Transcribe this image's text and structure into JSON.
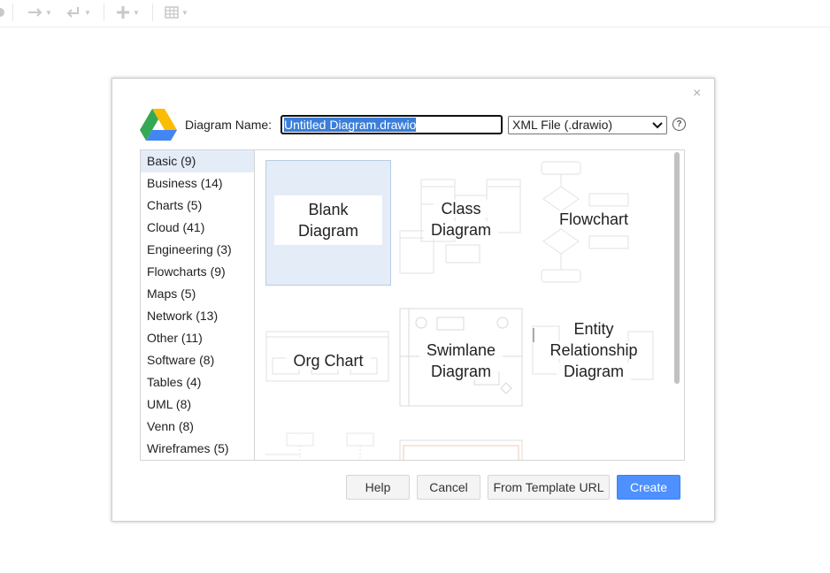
{
  "dialog": {
    "name_label": "Diagram Name:",
    "name_value": "Untitled Diagram.drawio",
    "format_selected": "XML File (.drawio)",
    "help_glyph": "?",
    "close_glyph": "×"
  },
  "categories": [
    {
      "label": "Basic (9)",
      "selected": true
    },
    {
      "label": "Business (14)"
    },
    {
      "label": "Charts (5)"
    },
    {
      "label": "Cloud (41)"
    },
    {
      "label": "Engineering (3)"
    },
    {
      "label": "Flowcharts (9)"
    },
    {
      "label": "Maps (5)"
    },
    {
      "label": "Network (13)"
    },
    {
      "label": "Other (11)"
    },
    {
      "label": "Software (8)"
    },
    {
      "label": "Tables (4)"
    },
    {
      "label": "UML (8)"
    },
    {
      "label": "Venn (8)"
    },
    {
      "label": "Wireframes (5)"
    }
  ],
  "templates": [
    {
      "line1": "Blank",
      "line2": "Diagram",
      "selected": true
    },
    {
      "line1": "Class",
      "line2": "Diagram"
    },
    {
      "line1": "Flowchart",
      "line2": ""
    },
    {
      "line1": "Org Chart",
      "line2": ""
    },
    {
      "line1": "Swimlane",
      "line2": "Diagram"
    },
    {
      "line1": "Entity",
      "line2": "Relationship",
      "line3": "Diagram"
    }
  ],
  "buttons": {
    "help": "Help",
    "cancel": "Cancel",
    "template_url": "From Template URL",
    "create": "Create"
  },
  "colors": {
    "primary": "#4d90fe",
    "selection": "#e4ecf7",
    "text_highlight": "#3b7ed8"
  },
  "icons": [
    "undo-icon",
    "redo-icon",
    "plus-icon",
    "table-icon",
    "google-drive-icon",
    "help-icon",
    "close-icon",
    "chevron-down-icon"
  ]
}
